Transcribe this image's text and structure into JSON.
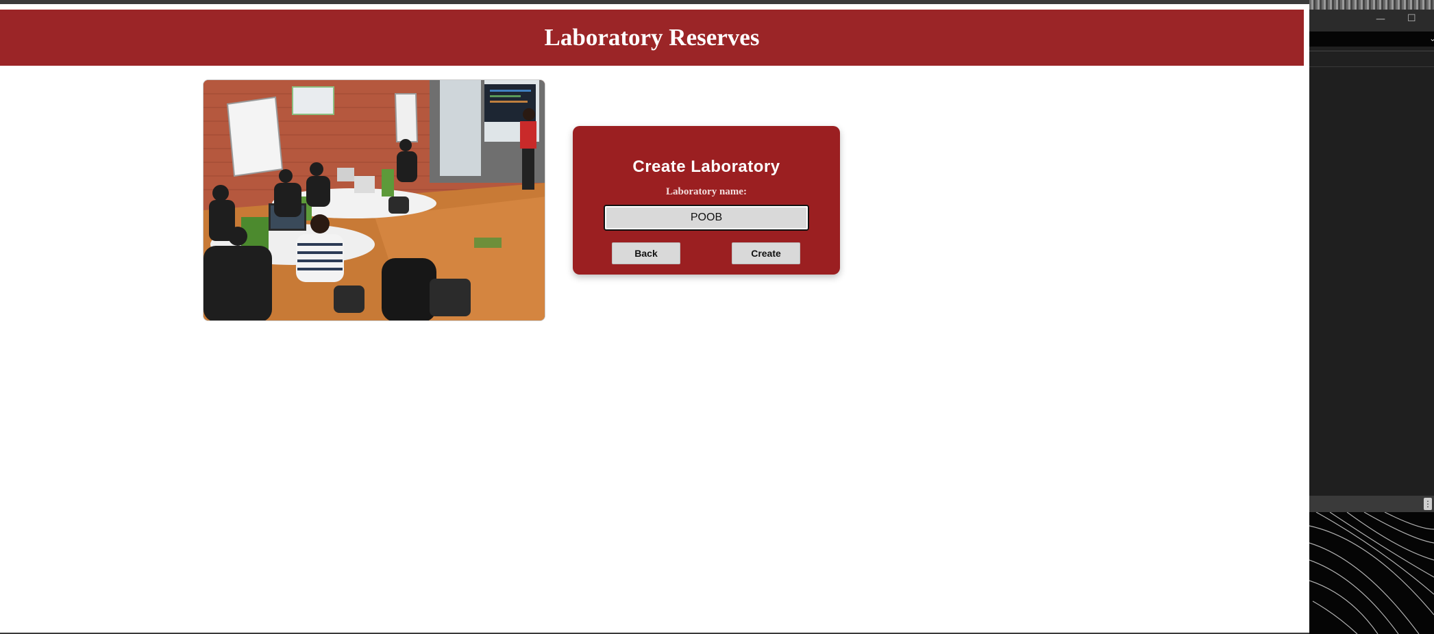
{
  "header": {
    "title": "Laboratory Reserves"
  },
  "photo": {
    "description_icon": "classroom-photo"
  },
  "form": {
    "title": "Create Laboratory",
    "label": "Laboratory name:",
    "input_value": "POOB",
    "back_label": "Back",
    "create_label": "Create"
  },
  "side_window": {
    "minimize_glyph": "—",
    "maximize_glyph": "☐",
    "chevron_glyph": "⌄",
    "menu_glyph": "⋮"
  },
  "colors": {
    "brand": "#9b2527",
    "card": "#9b1f21",
    "input_bg": "#d9d9d9"
  }
}
